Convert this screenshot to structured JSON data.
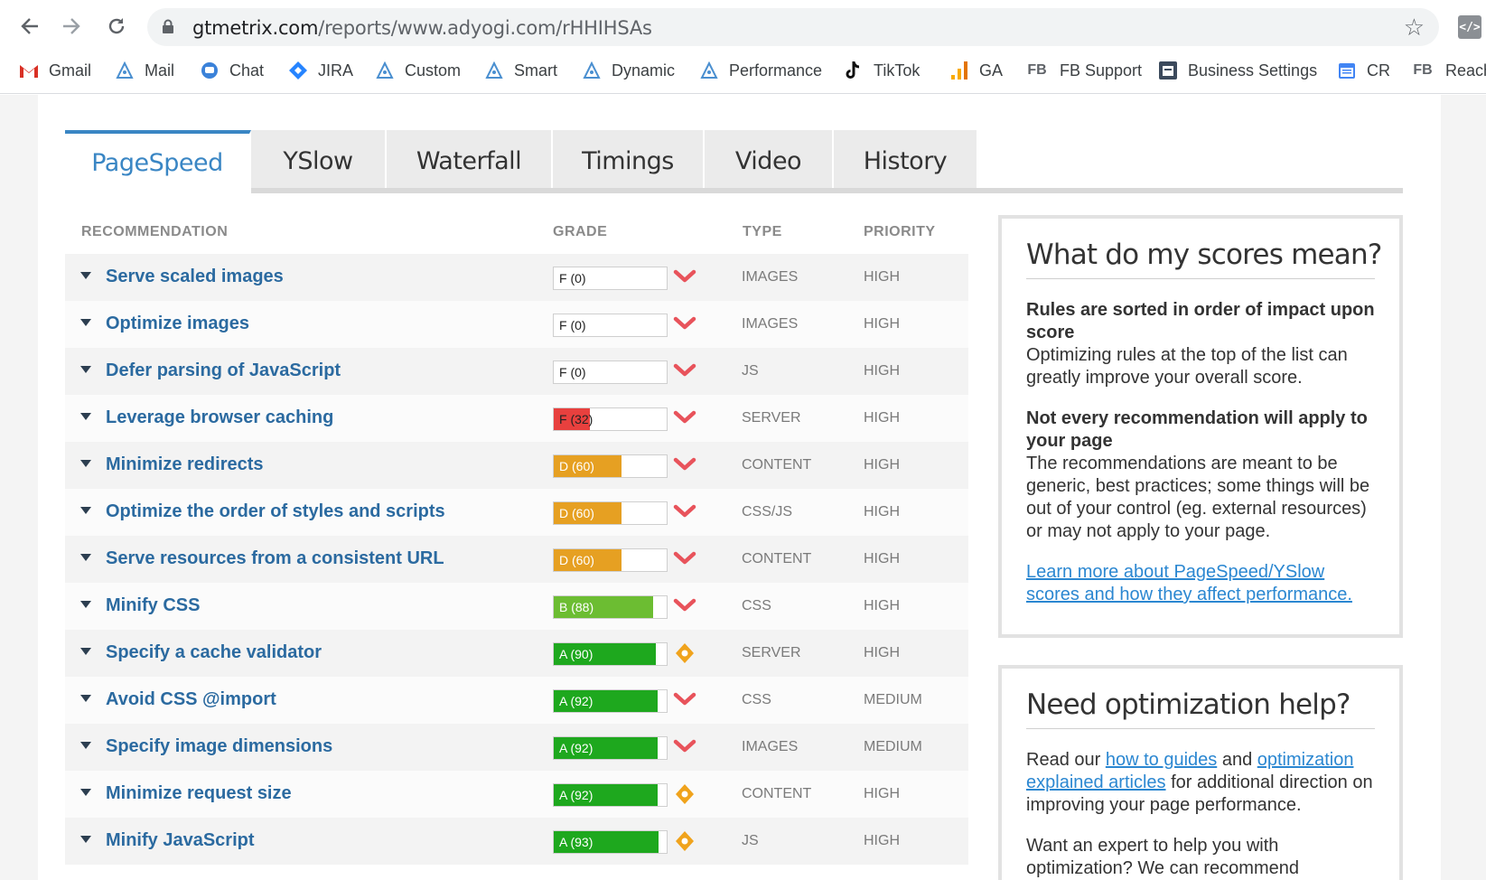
{
  "browser": {
    "url_host": "gtmetrix.com",
    "url_path": "/reports/www.adyogi.com/rHHIHSAs",
    "ext_label": "</>"
  },
  "bookmarks": [
    {
      "label": "Gmail",
      "icon": "gmail-icon"
    },
    {
      "label": "Mail",
      "icon": "bookmark-icon"
    },
    {
      "label": "Chat",
      "icon": "chat-icon"
    },
    {
      "label": "JIRA",
      "icon": "jira-icon"
    },
    {
      "label": "Custom",
      "icon": "bookmark-icon"
    },
    {
      "label": "Smart",
      "icon": "bookmark-icon"
    },
    {
      "label": "Dynamic",
      "icon": "bookmark-icon"
    },
    {
      "label": "Performance",
      "icon": "bookmark-icon"
    },
    {
      "label": "TikTok",
      "icon": "tiktok-icon"
    },
    {
      "label": "GA",
      "icon": "analytics-icon"
    },
    {
      "label": "FB Support",
      "icon": "fb-icon"
    },
    {
      "label": "Business Settings",
      "icon": "settings-icon"
    },
    {
      "label": "CR",
      "icon": "calendar-icon"
    },
    {
      "label": "Reach",
      "icon": "fb-icon"
    }
  ],
  "tabs": [
    "PageSpeed",
    "YSlow",
    "Waterfall",
    "Timings",
    "Video",
    "History"
  ],
  "table": {
    "headers": {
      "recommendation": "RECOMMENDATION",
      "grade": "GRADE",
      "type": "TYPE",
      "priority": "PRIORITY"
    },
    "rows": [
      {
        "rec": "Serve scaled images",
        "grade": "F (0)",
        "score": 0,
        "type": "IMAGES",
        "priority": "HIGH",
        "trend": "down"
      },
      {
        "rec": "Optimize images",
        "grade": "F (0)",
        "score": 0,
        "type": "IMAGES",
        "priority": "HIGH",
        "trend": "down"
      },
      {
        "rec": "Defer parsing of JavaScript",
        "grade": "F (0)",
        "score": 0,
        "type": "JS",
        "priority": "HIGH",
        "trend": "down"
      },
      {
        "rec": "Leverage browser caching",
        "grade": "F (32)",
        "score": 32,
        "type": "SERVER",
        "priority": "HIGH",
        "trend": "down"
      },
      {
        "rec": "Minimize redirects",
        "grade": "D (60)",
        "score": 60,
        "type": "CONTENT",
        "priority": "HIGH",
        "trend": "down"
      },
      {
        "rec": "Optimize the order of styles and scripts",
        "grade": "D (60)",
        "score": 60,
        "type": "CSS/JS",
        "priority": "HIGH",
        "trend": "down"
      },
      {
        "rec": "Serve resources from a consistent URL",
        "grade": "D (60)",
        "score": 60,
        "type": "CONTENT",
        "priority": "HIGH",
        "trend": "down"
      },
      {
        "rec": "Minify CSS",
        "grade": "B (88)",
        "score": 88,
        "type": "CSS",
        "priority": "HIGH",
        "trend": "down"
      },
      {
        "rec": "Specify a cache validator",
        "grade": "A (90)",
        "score": 90,
        "type": "SERVER",
        "priority": "HIGH",
        "trend": "same"
      },
      {
        "rec": "Avoid CSS @import",
        "grade": "A (92)",
        "score": 92,
        "type": "CSS",
        "priority": "MEDIUM",
        "trend": "down"
      },
      {
        "rec": "Specify image dimensions",
        "grade": "A (92)",
        "score": 92,
        "type": "IMAGES",
        "priority": "MEDIUM",
        "trend": "down"
      },
      {
        "rec": "Minimize request size",
        "grade": "A (92)",
        "score": 92,
        "type": "CONTENT",
        "priority": "HIGH",
        "trend": "same"
      },
      {
        "rec": "Minify JavaScript",
        "grade": "A (93)",
        "score": 93,
        "type": "JS",
        "priority": "HIGH",
        "trend": "same"
      }
    ]
  },
  "colors": {
    "F": "#e8403e",
    "D": "#e6a022",
    "B": "#6cbd32",
    "A": "#1ea81e",
    "trend_down": "#e8535b",
    "trend_same": "#f0a31c",
    "accent": "#3a86c4"
  },
  "scores_box": {
    "title": "What do my scores mean?",
    "p1_bold": "Rules are sorted in order of impact upon score",
    "p1_text": "Optimizing rules at the top of the list can greatly improve your overall score.",
    "p2_bold": "Not every recommendation will apply to your page",
    "p2_text": "The recommendations are meant to be generic, best practices; some things will be out of your control (eg. external resources) or may not apply to your page.",
    "link": "Learn more about PageSpeed/YSlow scores and how they affect performance."
  },
  "help_box": {
    "title": "Need optimization help?",
    "t1": "Read our ",
    "link1": "how to guides",
    "t2": " and ",
    "link2": "optimization explained articles",
    "t3": " for additional direction on improving your page performance.",
    "t4": "Want an expert to help you with optimization? We can recommend"
  }
}
